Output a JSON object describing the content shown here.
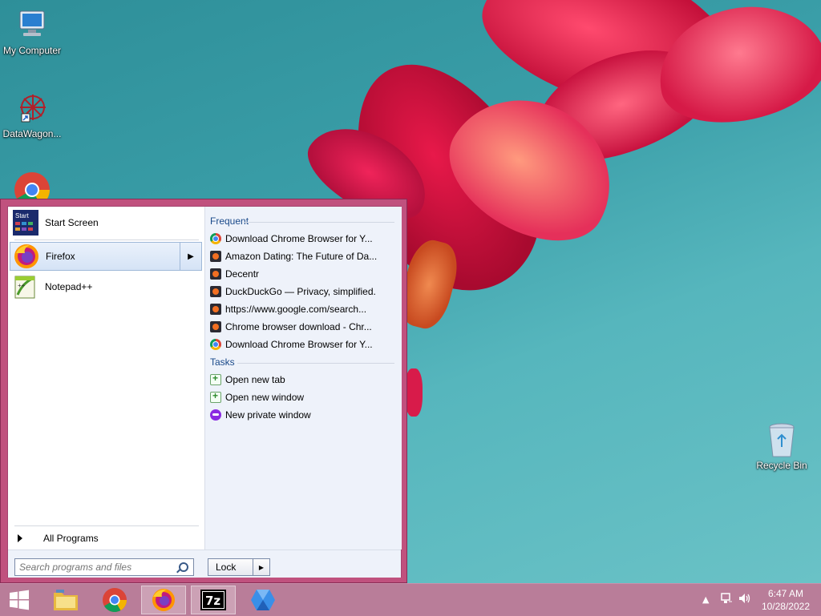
{
  "desktop": {
    "icons": [
      {
        "label": "My Computer"
      },
      {
        "label": "DataWagon..."
      },
      {
        "label": "Recycle Bin"
      }
    ]
  },
  "start_menu": {
    "programs": [
      {
        "label": "Start Screen",
        "icon": "start-screen-icon"
      },
      {
        "label": "Firefox",
        "icon": "firefox-icon",
        "has_submenu": true
      },
      {
        "label": "Notepad++",
        "icon": "notepad-plus-plus-icon"
      }
    ],
    "all_programs": "All Programs",
    "frequent_header": "Frequent",
    "frequent": [
      {
        "label": "Download Chrome Browser for Y...",
        "icon": "chrome-icon"
      },
      {
        "label": "Amazon Dating: The Future of Da...",
        "icon": "firefox-page-icon"
      },
      {
        "label": "Decentr",
        "icon": "firefox-page-icon"
      },
      {
        "label": "DuckDuckGo — Privacy, simplified.",
        "icon": "firefox-page-icon"
      },
      {
        "label": "https://www.google.com/search...",
        "icon": "firefox-page-icon"
      },
      {
        "label": "Chrome browser download - Chr...",
        "icon": "firefox-page-icon"
      },
      {
        "label": "Download Chrome Browser for Y...",
        "icon": "chrome-icon"
      }
    ],
    "tasks_header": "Tasks",
    "tasks": [
      {
        "label": "Open new tab",
        "icon": "new-tab-icon"
      },
      {
        "label": "Open new window",
        "icon": "new-window-icon"
      },
      {
        "label": "New private window",
        "icon": "private-window-icon"
      }
    ],
    "search_placeholder": "Search programs and files",
    "lock_label": "Lock"
  },
  "taskbar": {
    "items": [
      "windows-start-icon",
      "file-explorer-icon",
      "chrome-icon",
      "firefox-icon",
      "7zip-icon",
      "app-icon"
    ],
    "clock_time": "6:47 AM",
    "clock_date": "10/28/2022"
  },
  "colors": {
    "menu_border": "#c0517e",
    "header_blue": "#1a4a8a"
  }
}
